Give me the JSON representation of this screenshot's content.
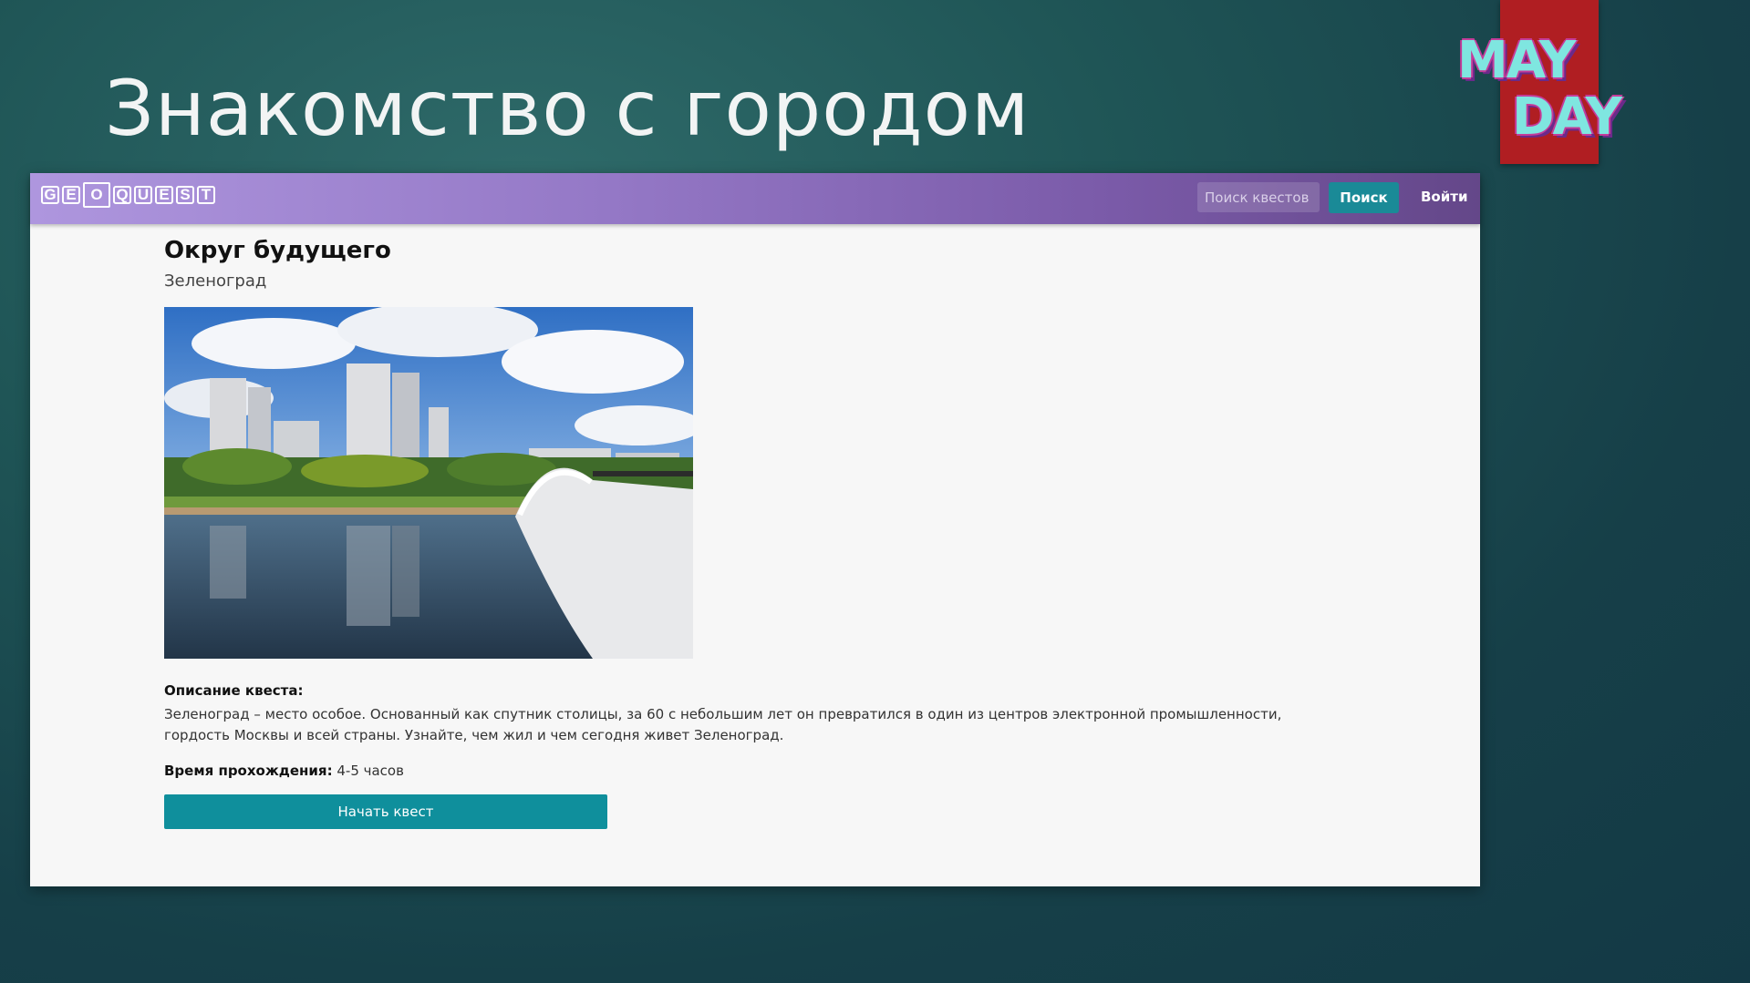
{
  "slide": {
    "title": "Знакомство с городом"
  },
  "badge": {
    "line1": "MAY",
    "line2": "DAY"
  },
  "navbar": {
    "logo_letters": [
      "G",
      "E",
      "O",
      "Q",
      "U",
      "E",
      "S",
      "T"
    ],
    "search_placeholder": "Поиск квестов",
    "search_button": "Поиск",
    "login": "Войти"
  },
  "quest": {
    "title": "Округ будущего",
    "city": "Зеленоград",
    "description_label": "Описание квеста:",
    "description": "Зеленоград – место особое. Основанный как спутник столицы, за 60 с небольшим лет он превратился в один из центров электронной промышленности, гордость Москвы и всей страны. Узнайте, чем жил и чем сегодня живет Зеленоград.",
    "time_label": "Время прохождения:",
    "time_value": "4-5 часов",
    "start_button": "Начать квест"
  },
  "colors": {
    "accent": "#0f8f9c",
    "navbar_start": "#ae96de",
    "navbar_end": "#644789",
    "badge": "#b01e22"
  }
}
